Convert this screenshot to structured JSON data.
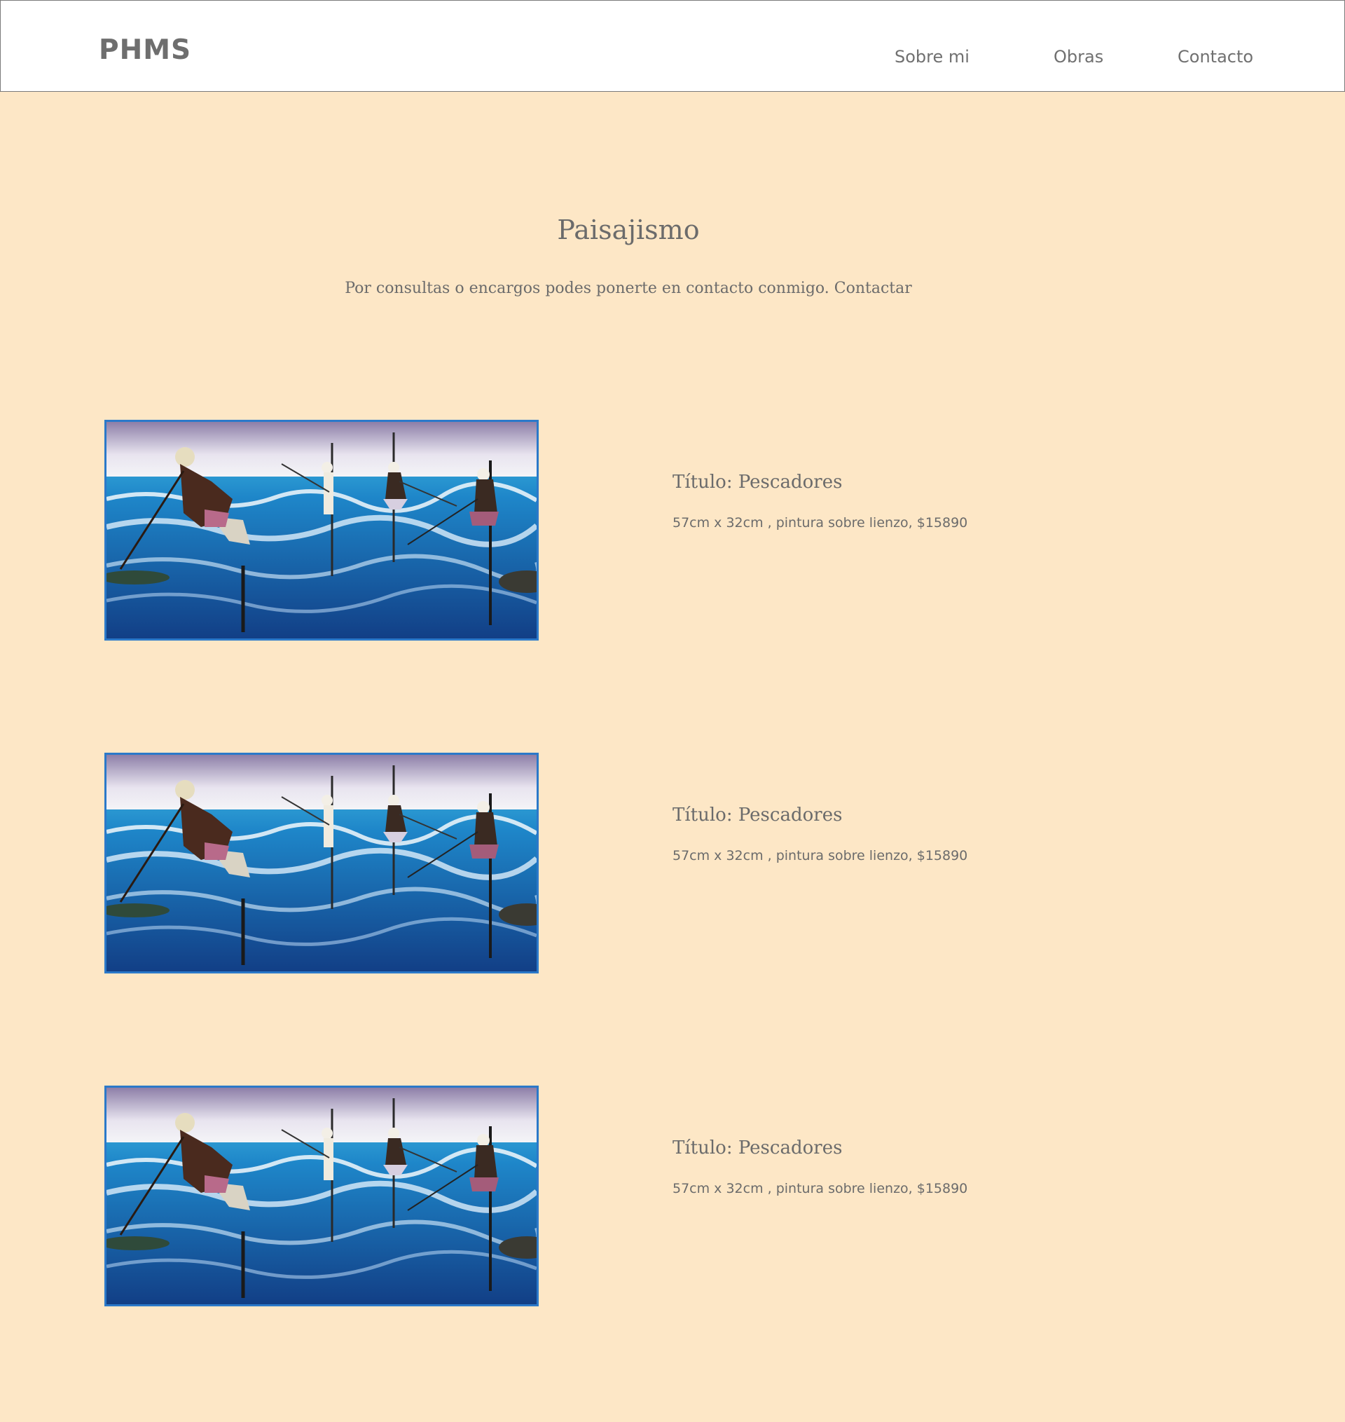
{
  "header": {
    "logo": "PHMS",
    "nav": {
      "about": "Sobre mi",
      "works": "Obras",
      "contact": "Contacto"
    }
  },
  "main": {
    "title": "Paisajismo",
    "intro_text": "Por consultas o encargos podes ponerte en contacto conmigo. ",
    "intro_link": "Contactar",
    "artworks": [
      {
        "title": "Título: Pescadores",
        "description": "57cm x 32cm , pintura sobre lienzo, $15890"
      },
      {
        "title": "Título: Pescadores",
        "description": "57cm x 32cm , pintura sobre lienzo, $15890"
      },
      {
        "title": "Título: Pescadores",
        "description": "57cm x 32cm , pintura sobre lienzo, $15890"
      }
    ]
  },
  "colors": {
    "background": "#fde7c6",
    "header_background": "#ffffff",
    "text": "#6b6b6b",
    "frame": "#2b79c9"
  }
}
